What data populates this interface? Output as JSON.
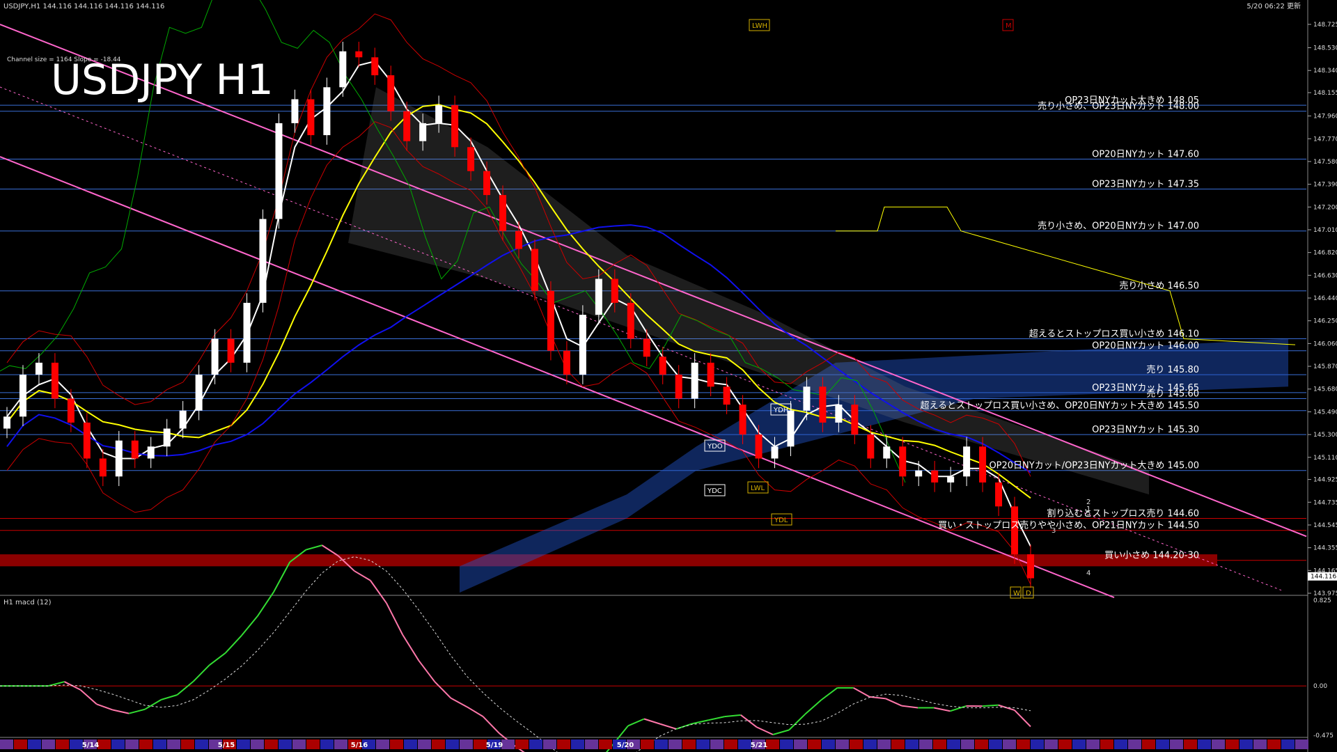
{
  "header": {
    "symbol_ohlc": "USDJPY,H1  144.116 144.116 144.116 144.116",
    "updated": "5/20 06:22 更新",
    "channel_info": "Channel size = 1164 Slope = -18.44",
    "big_title": "USDJPY H1",
    "macd_title": "H1  macd (12)"
  },
  "colors": {
    "background": "#000000",
    "level_line": "#3a6fd8",
    "support_zone": "#8b0000",
    "channel": "#ff66cc",
    "sma_white": "#ffffff",
    "sma_yellow": "#ffff00",
    "sma_blue": "#1010ee",
    "envelope_red": "#cc0000",
    "chikou_green": "#00aa00",
    "kumo_blue": "#2255cc",
    "candle_up": "#ffffff",
    "candle_down": "#ff0000",
    "macd_up": "#33dd33",
    "macd_down": "#ff77aa",
    "resistance_red": "#cc0000",
    "box_yellow": "#d4b000",
    "box_white": "#ffffff"
  },
  "chart_data": {
    "type": "candlestick",
    "symbol": "USDJPY",
    "timeframe": "H1",
    "last_price": "144.116",
    "price_ticks": [
      "148.725",
      "148.530",
      "148.340",
      "148.155",
      "147.960",
      "147.770",
      "147.580",
      "147.390",
      "147.200",
      "147.010",
      "146.820",
      "146.630",
      "146.440",
      "146.250",
      "146.060",
      "145.870",
      "145.680",
      "145.490",
      "145.300",
      "145.110",
      "144.925",
      "144.735",
      "144.545",
      "144.355",
      "144.165",
      "143.975"
    ],
    "price_range": [
      143.975,
      148.725
    ],
    "date_labels": [
      "5/14",
      "5/15",
      "5/16",
      "5/19",
      "5/20",
      "5/21"
    ],
    "level_annotations": [
      {
        "text": "OP23日NYカット大きめ 148.05",
        "price": 148.05
      },
      {
        "text": "売り小さめ、OP23日NYカット 148.00",
        "price": 148.0
      },
      {
        "text": "OP20日NYカット 147.60",
        "price": 147.6
      },
      {
        "text": "OP23日NYカット 147.35",
        "price": 147.35
      },
      {
        "text": "売り小さめ、OP20日NYカット 147.00",
        "price": 147.0
      },
      {
        "text": "売り小さめ 146.50",
        "price": 146.5
      },
      {
        "text": "超えるとストップロス買い小さめ 146.10",
        "price": 146.1
      },
      {
        "text": "OP20日NYカット 146.00",
        "price": 146.0
      },
      {
        "text": "売り 145.80",
        "price": 145.8
      },
      {
        "text": "OP23日NYカット 145.65",
        "price": 145.65
      },
      {
        "text": "売り 145.60",
        "price": 145.6
      },
      {
        "text": "超えるとストップロス買い小さめ、OP20日NYカット大きめ 145.50",
        "price": 145.5
      },
      {
        "text": "OP23日NYカット 145.30",
        "price": 145.3
      },
      {
        "text": "OP20日NYカット/OP23日NYカット大きめ 145.00",
        "price": 145.0
      },
      {
        "text": "割り込むとストップロス売り 144.60",
        "price": 144.6
      },
      {
        "text": "買い・ストップロス売りやや小さめ、OP21日NYカット 144.50",
        "price": 144.5
      },
      {
        "text": "買い小さめ 144.20-30",
        "price": 144.25
      }
    ],
    "boxes": [
      {
        "text": "LWH",
        "color": "yellow"
      },
      {
        "text": "M",
        "color": "red"
      },
      {
        "text": "YDH",
        "color": "white"
      },
      {
        "text": "YDO",
        "color": "white"
      },
      {
        "text": "YDC",
        "color": "white"
      },
      {
        "text": "LWL",
        "color": "yellow"
      },
      {
        "text": "YDL",
        "color": "yellow"
      },
      {
        "text": "W",
        "color": "yellow"
      },
      {
        "text": "D",
        "color": "yellow"
      }
    ],
    "wave_labels": [
      "2",
      "1",
      "5",
      "3",
      "4"
    ],
    "macd_ticks": [
      "0.825",
      "0.00",
      "-0.475"
    ],
    "macd_range": [
      -0.475,
      0.825
    ],
    "closes": [
      145.45,
      145.8,
      145.9,
      145.6,
      145.4,
      145.1,
      144.95,
      145.25,
      145.1,
      145.2,
      145.35,
      145.5,
      145.8,
      146.1,
      145.9,
      146.4,
      147.1,
      147.9,
      148.1,
      147.8,
      148.2,
      148.5,
      148.45,
      148.3,
      148.0,
      147.75,
      147.9,
      148.05,
      147.7,
      147.5,
      147.3,
      147.0,
      146.85,
      146.5,
      146.0,
      145.8,
      146.3,
      146.6,
      146.4,
      146.1,
      145.95,
      145.8,
      145.6,
      145.9,
      145.7,
      145.55,
      145.3,
      145.1,
      145.2,
      145.5,
      145.7,
      145.4,
      145.55,
      145.3,
      145.1,
      145.2,
      144.95,
      145.0,
      144.9,
      144.95,
      145.2,
      144.9,
      144.7,
      144.3,
      144.1
    ]
  }
}
